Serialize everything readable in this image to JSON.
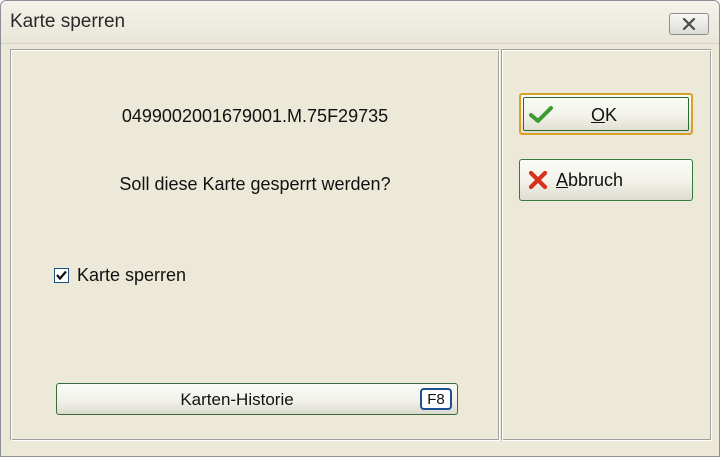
{
  "window": {
    "title": "Karte sperren"
  },
  "main": {
    "card_number": "0499002001679001.M.75F29735",
    "question": "Soll diese Karte gesperrt werden?",
    "checkbox": {
      "label": "Karte sperren",
      "checked": true
    },
    "history_button": {
      "label": "Karten-Historie",
      "shortcut": "F8"
    }
  },
  "actions": {
    "ok": {
      "mnemonic": "O",
      "rest": "K",
      "icon": "checkmark-icon",
      "icon_color": "#3c9a2e"
    },
    "cancel": {
      "mnemonic": "A",
      "rest": "bbruch",
      "icon": "red-x-icon",
      "icon_color": "#d8321f"
    }
  },
  "colors": {
    "dialog_background": "#ece9d8",
    "default_button_focus": "#d9a12b",
    "button_border": "#3a7a3e",
    "shortcut_border": "#1d4f93"
  }
}
